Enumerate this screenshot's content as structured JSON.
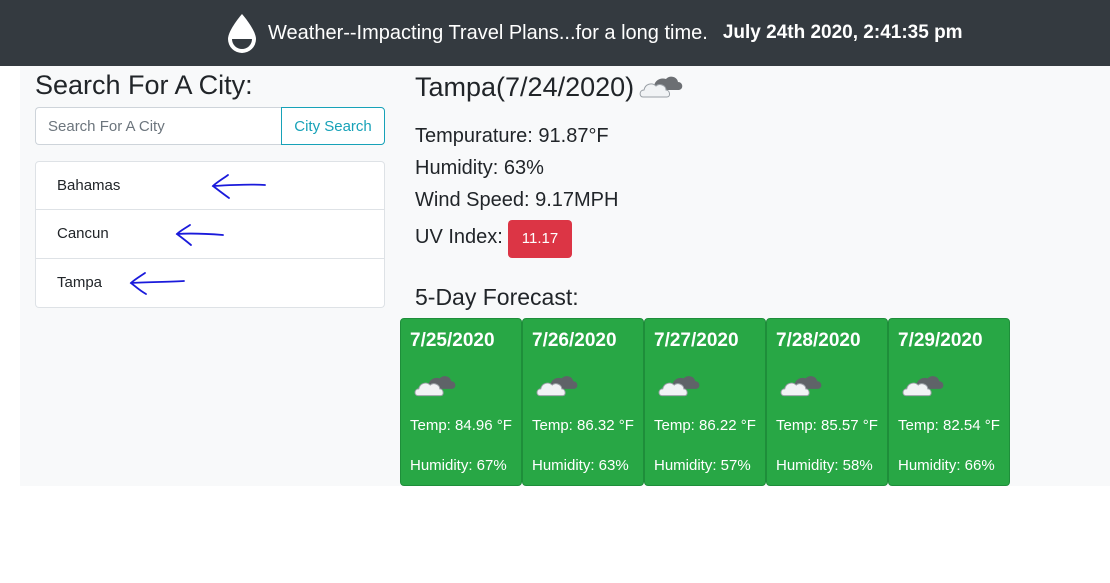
{
  "header": {
    "title": "Weather--Impacting Travel Plans...for a long time.",
    "datetime": "July 24th 2020, 2:41:35 pm",
    "icon": "water-drop-icon"
  },
  "search": {
    "heading": "Search For A City:",
    "placeholder": "Search For A City",
    "button_label": "City Search"
  },
  "history": {
    "items": [
      {
        "label": "Bahamas"
      },
      {
        "label": "Cancun"
      },
      {
        "label": "Tampa"
      }
    ],
    "annotation_icon": "hand-drawn-arrow-icon",
    "annotation_color": "#1a1adb"
  },
  "current": {
    "title": "Tampa(7/24/2020)",
    "icon": "cloud-icon",
    "temperature": "Tempurature: 91.87°F",
    "humidity": "Humidity: 63%",
    "wind": "Wind Speed: 9.17MPH",
    "uv_label": "UV Index:",
    "uv_value": "11.17",
    "uv_color": "#dc3545"
  },
  "forecast": {
    "heading": "5-Day Forecast:",
    "card_color": "#28a745",
    "days": [
      {
        "date": "7/25/2020",
        "icon": "cloud-icon",
        "temp": "Temp: 84.96 °F",
        "humidity": "Humidity: 67%"
      },
      {
        "date": "7/26/2020",
        "icon": "cloud-icon",
        "temp": "Temp: 86.32 °F",
        "humidity": "Humidity: 63%"
      },
      {
        "date": "7/27/2020",
        "icon": "cloud-icon",
        "temp": "Temp: 86.22 °F",
        "humidity": "Humidity: 57%"
      },
      {
        "date": "7/28/2020",
        "icon": "cloud-icon",
        "temp": "Temp: 85.57 °F",
        "humidity": "Humidity: 58%"
      },
      {
        "date": "7/29/2020",
        "icon": "cloud-icon",
        "temp": "Temp: 82.54 °F",
        "humidity": "Humidity: 66%"
      }
    ]
  }
}
